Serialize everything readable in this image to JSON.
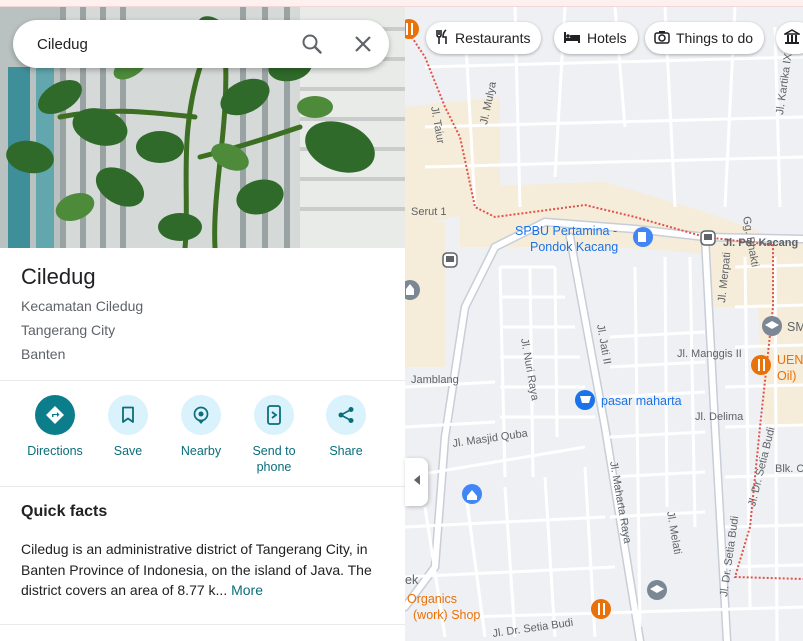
{
  "search": {
    "value": "Ciledug"
  },
  "place": {
    "name": "Ciledug",
    "address_lines": [
      "Kecamatan Ciledug",
      "Tangerang City",
      "Banten"
    ]
  },
  "actions": [
    {
      "label": "Directions",
      "icon": "directions-icon"
    },
    {
      "label": "Save",
      "icon": "bookmark-icon"
    },
    {
      "label": "Nearby",
      "icon": "nearby-icon"
    },
    {
      "label_line1": "Send to",
      "label_line2": "phone",
      "icon": "send-to-phone-icon"
    },
    {
      "label": "Share",
      "icon": "share-icon"
    }
  ],
  "quick_facts": {
    "title": "Quick facts",
    "text": "Ciledug is an administrative district of Tangerang City, in Banten Province of Indonesia, on the island of Java. The district covers an area of 8.77 k...",
    "more": "More"
  },
  "chips": [
    "Restaurants",
    "Hotels",
    "Things to do"
  ],
  "map": {
    "streets": [
      "Jl. Taiur",
      "Jl. Mulya",
      "Jl. Kartika IX",
      "Gg. Bhakti",
      "Serut 1",
      "Jl. Pd. Kacang",
      "Jl. Merpati",
      "Jl. Nuri Raya",
      "Jl. Jati II",
      "Jl. Manggis II",
      "Jamblang",
      "Jl. Delima",
      "Jl. Masjid Quba",
      "Jl. Maharta Raya",
      "Jl. Melati",
      "Jl. Dr. Setia Budi",
      "Blk. C",
      "Jl. Dr. Setia Budi"
    ],
    "pois": [
      {
        "line1": "SPBU Pertamina -",
        "line2": "Pondok Kacang"
      },
      {
        "line1": "pasar maharta"
      },
      {
        "line1": "SM"
      },
      {
        "line1": "UEN",
        "line2": "Oil)"
      },
      {
        "line1": "ek"
      },
      {
        "line1": "Organics",
        "line2": "(work) Shop"
      }
    ]
  },
  "colors": {
    "accent": "#0b7d8b",
    "accent_light": "#d9f2fc",
    "boundary": "#e0534a",
    "poi_blue": "#1a73e8",
    "poi_orange": "#e8710a"
  }
}
